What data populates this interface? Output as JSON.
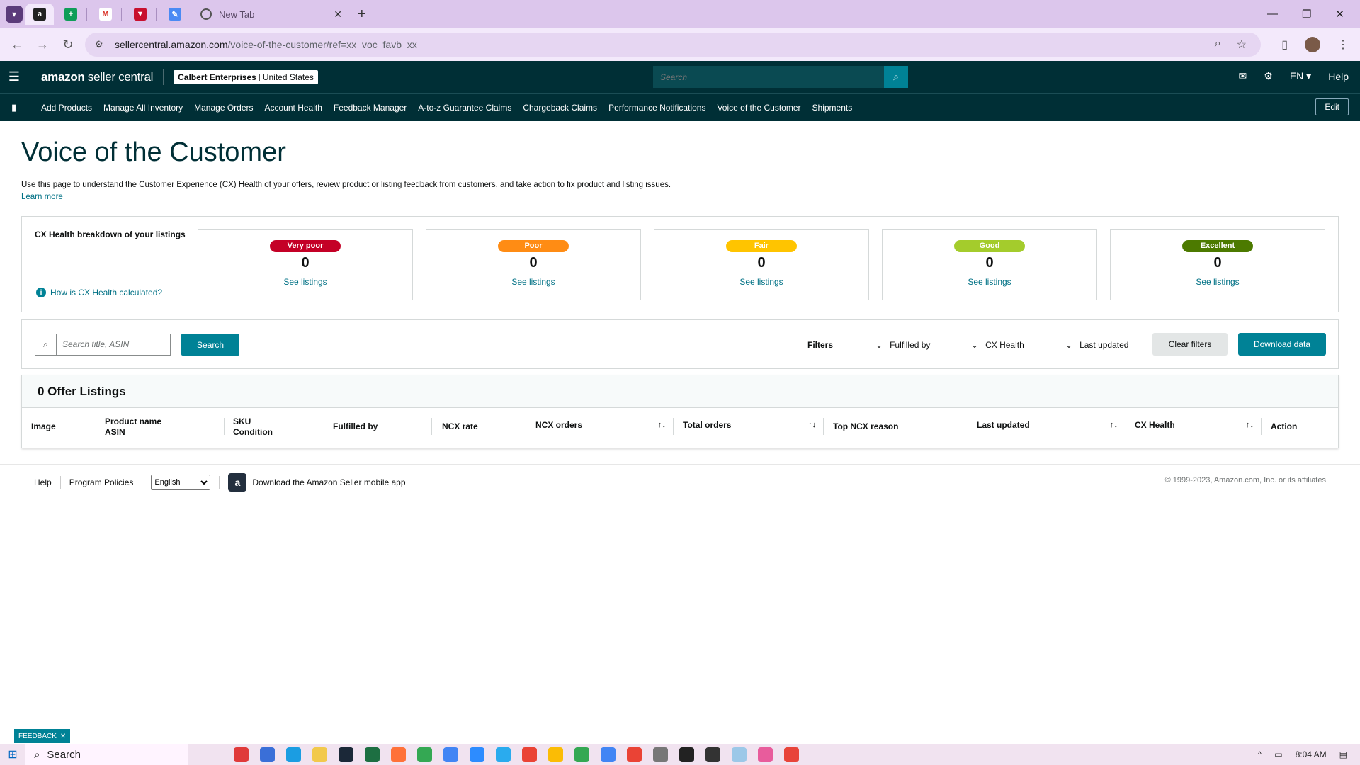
{
  "browser": {
    "tabs": [
      {
        "icon": "amazon-icon",
        "active": true
      },
      {
        "icon": "sheets-icon"
      },
      {
        "icon": "gmail-icon"
      },
      {
        "icon": "vpn-icon"
      },
      {
        "icon": "pen-icon"
      }
    ],
    "new_tab_label": "New Tab",
    "url_domain": "sellercentral.amazon.com",
    "url_path": "/voice-of-the-customer/ref=xx_voc_favb_xx"
  },
  "header": {
    "logo_bold": "amazon",
    "logo_light": " seller central",
    "account_name": "Calbert Enterprises",
    "account_region": "United States",
    "search_placeholder": "Search",
    "language": "EN",
    "help": "Help"
  },
  "nav": {
    "items": [
      "Add Products",
      "Manage All Inventory",
      "Manage Orders",
      "Account Health",
      "Feedback Manager",
      "A-to-z Guarantee Claims",
      "Chargeback Claims",
      "Performance Notifications",
      "Voice of the Customer",
      "Shipments"
    ],
    "edit": "Edit"
  },
  "page": {
    "title": "Voice of the Customer",
    "description": "Use this page to understand the Customer Experience (CX) Health of your offers, review product or listing feedback from customers, and take action to fix product and listing issues.",
    "learn_more": "Learn more"
  },
  "health": {
    "label": "CX Health breakdown of your listings",
    "calc_link": "How is CX Health calculated?",
    "cards": [
      {
        "badge": "Very poor",
        "color": "#c40026",
        "count": "0",
        "link": "See listings"
      },
      {
        "badge": "Poor",
        "color": "#ff8c14",
        "count": "0",
        "link": "See listings"
      },
      {
        "badge": "Fair",
        "color": "#ffc400",
        "count": "0",
        "link": "See listings"
      },
      {
        "badge": "Good",
        "color": "#a4cc2c",
        "count": "0",
        "link": "See listings"
      },
      {
        "badge": "Excellent",
        "color": "#4c7a00",
        "count": "0",
        "link": "See listings"
      }
    ]
  },
  "filters": {
    "search_placeholder": "Search title, ASIN",
    "search_button": "Search",
    "label": "Filters",
    "fulfilled_by": "Fulfilled by",
    "cx_health": "CX Health",
    "last_updated": "Last updated",
    "clear": "Clear filters",
    "download": "Download data"
  },
  "listings": {
    "heading": "0 Offer Listings",
    "columns": {
      "image": "Image",
      "product_name": "Product name",
      "asin": "ASIN",
      "sku": "SKU",
      "condition": "Condition",
      "fulfilled_by": "Fulfilled by",
      "ncx_rate": "NCX rate",
      "ncx_orders": "NCX orders",
      "total_orders": "Total orders",
      "top_ncx_reason": "Top NCX reason",
      "last_updated": "Last updated",
      "cx_health": "CX Health",
      "action": "Action"
    }
  },
  "footer": {
    "help": "Help",
    "policies": "Program Policies",
    "language": "English",
    "app_link": "Download the Amazon Seller mobile app",
    "copyright": "© 1999-2023, Amazon.com, Inc. or its affiliates",
    "feedback": "FEEDBACK"
  },
  "taskbar": {
    "search": "Search",
    "time": "8:04 AM"
  },
  "colors": {
    "teal": "#008296",
    "dark_header": "#002f36",
    "link": "#007185"
  }
}
